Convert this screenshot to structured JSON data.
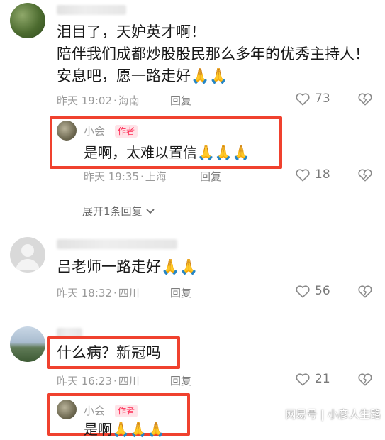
{
  "comments": [
    {
      "lines": [
        "泪目了，天妒英才啊！",
        "陪伴我们成都炒股股民那么多年的优秀主持人！",
        "安息吧，愿一路走好🙏🙏"
      ],
      "time": "昨天 19:02",
      "location": "海南",
      "reply_label": "回复",
      "likes": "73"
    },
    {
      "author": "小会",
      "badge": "作者",
      "text": "是啊，太难以置信🙏🙏🙏",
      "time": "昨天 19:35",
      "location": "上海",
      "reply_label": "回复",
      "likes": "18"
    },
    {
      "expand_label": "展开1条回复"
    },
    {
      "text": "吕老师一路走好🙏🙏",
      "time": "昨天 18:32",
      "location": "四川",
      "reply_label": "回复",
      "likes": "56"
    },
    {
      "text": "什么病？新冠吗",
      "time": "昨天 16:23",
      "location": "四川",
      "reply_label": "回复",
      "likes": "21"
    },
    {
      "author": "小会",
      "badge": "作者",
      "text": "是啊🙏🙏🙏"
    }
  ],
  "watermark": "网易号 | 小彦人生路",
  "colors": {
    "highlight_box": "#f0412e",
    "author_badge": "#fe2c55"
  },
  "icons": [
    "heart-icon",
    "broken-heart-icon",
    "chevron-down-icon"
  ]
}
